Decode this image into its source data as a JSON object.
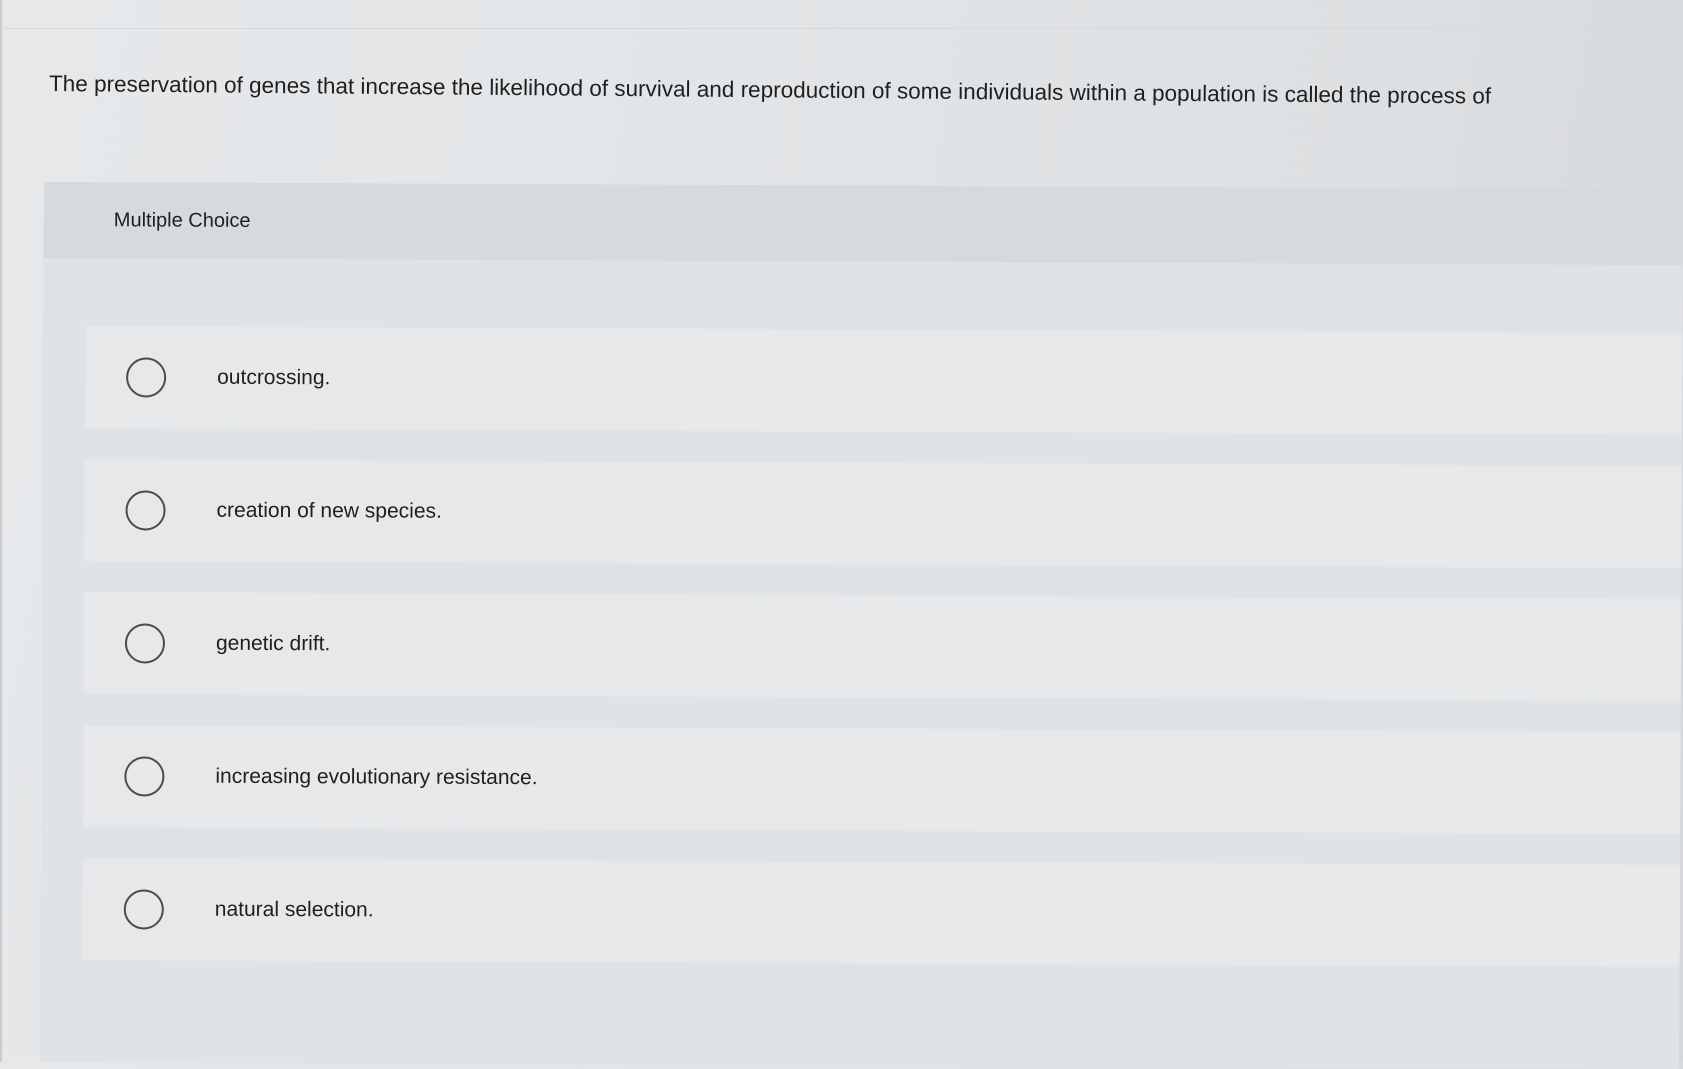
{
  "question": {
    "text": "The preservation of genes that increase the likelihood of survival and reproduction of some individuals within a population is called the process of"
  },
  "multiple_choice": {
    "header": "Multiple Choice",
    "options": [
      {
        "label": "outcrossing.",
        "selected": false
      },
      {
        "label": "creation of new species.",
        "selected": false
      },
      {
        "label": "genetic drift.",
        "selected": false
      },
      {
        "label": "increasing evolutionary resistance.",
        "selected": false
      },
      {
        "label": "natural selection.",
        "selected": false
      }
    ]
  },
  "colors": {
    "page_background": "#e2e5e7",
    "panel_background": "#d9dcde",
    "option_background": "#e6e8ea",
    "radio_border": "#4a4d50",
    "text": "#1f1f1f"
  },
  "icons": {
    "radio": "radio-unchecked-icon"
  }
}
